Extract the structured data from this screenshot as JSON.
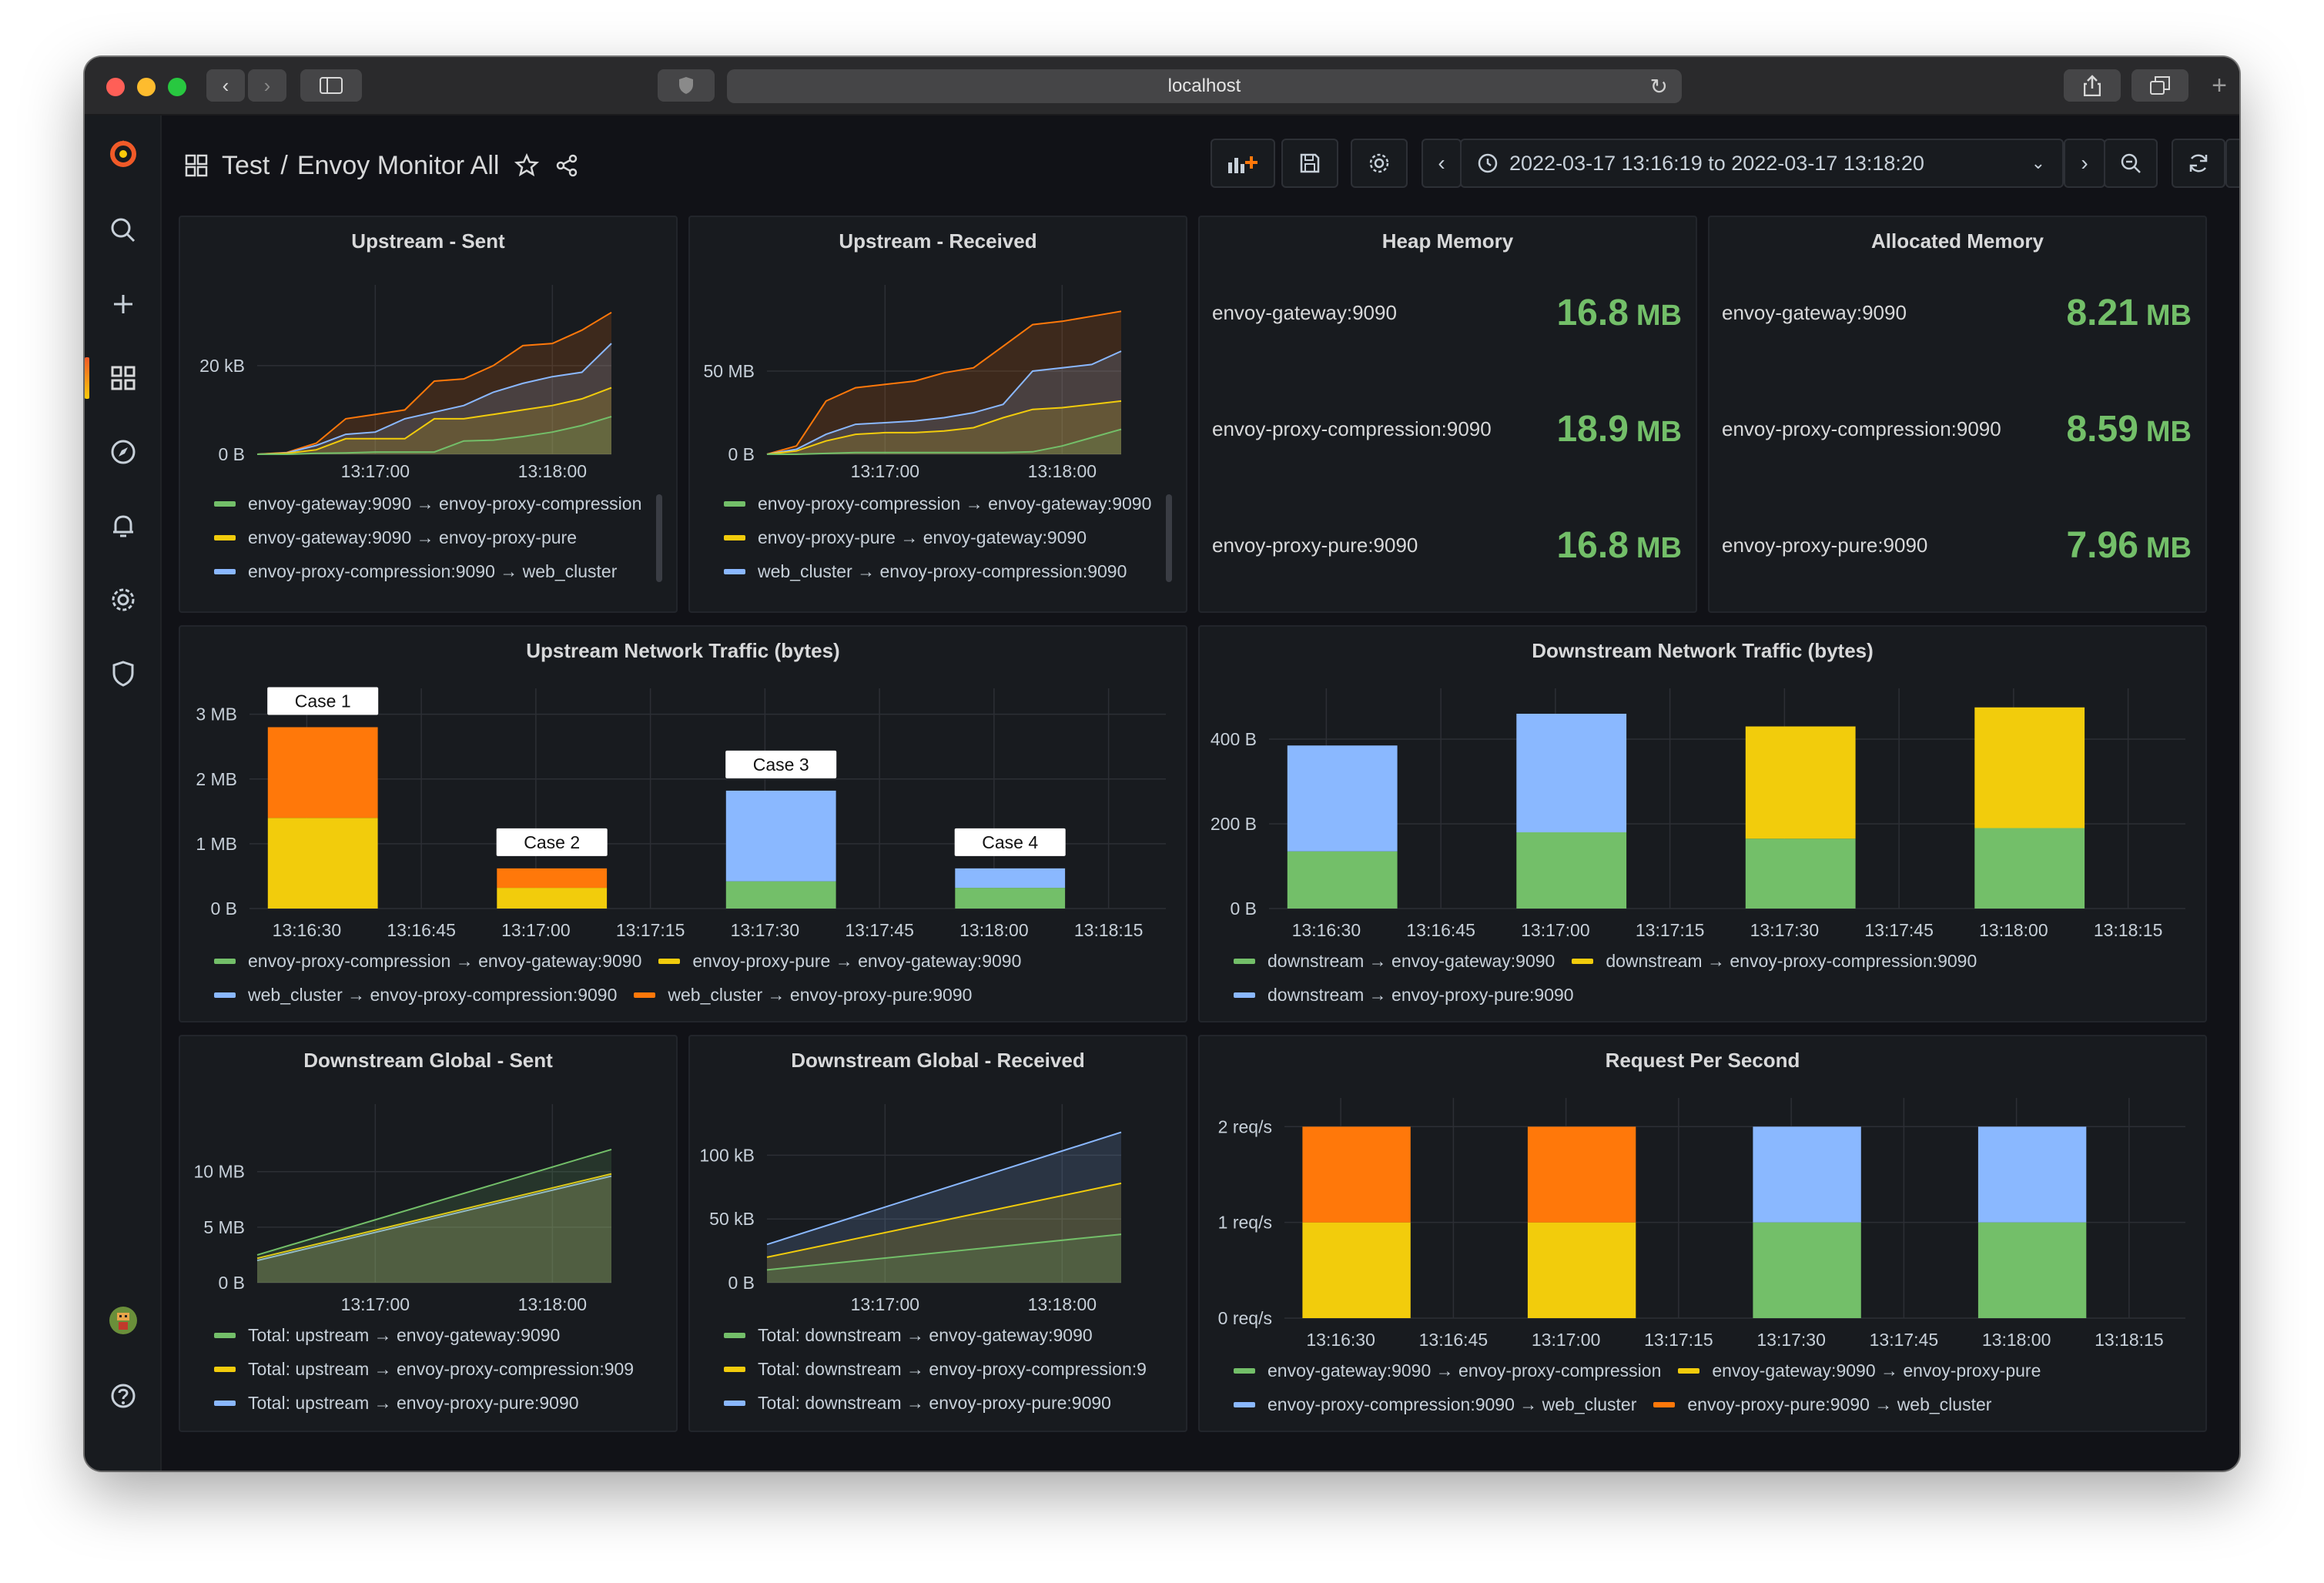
{
  "browser": {
    "url": "localhost"
  },
  "breadcrumb": {
    "folder": "Test",
    "separator": "/",
    "dashboard": "Envoy Monitor All"
  },
  "timepicker": {
    "range": "2022-03-17 13:16:19 to 2022-03-17 13:18:20"
  },
  "colors": {
    "green": "#73bf69",
    "yellow": "#f2cc0c",
    "blue": "#8ab8ff",
    "orange": "#ff780a",
    "stat": "#73bf69"
  },
  "panels": {
    "upstream_sent": {
      "title": "Upstream - Sent",
      "legend": [
        {
          "label": "envoy-gateway:9090 → envoy-proxy-compression",
          "color": "#73bf69"
        },
        {
          "label": "envoy-gateway:9090 → envoy-proxy-pure",
          "color": "#f2cc0c"
        },
        {
          "label": "envoy-proxy-compression:9090 → web_cluster",
          "color": "#8ab8ff"
        }
      ]
    },
    "upstream_received": {
      "title": "Upstream - Received",
      "legend": [
        {
          "label": "envoy-proxy-compression → envoy-gateway:9090",
          "color": "#73bf69"
        },
        {
          "label": "envoy-proxy-pure → envoy-gateway:9090",
          "color": "#f2cc0c"
        },
        {
          "label": "web_cluster → envoy-proxy-compression:9090",
          "color": "#8ab8ff"
        }
      ]
    },
    "heap_memory": {
      "title": "Heap Memory",
      "rows": [
        {
          "name": "envoy-gateway:9090",
          "value": "16.8",
          "unit": "MB"
        },
        {
          "name": "envoy-proxy-compression:9090",
          "value": "18.9",
          "unit": "MB"
        },
        {
          "name": "envoy-proxy-pure:9090",
          "value": "16.8",
          "unit": "MB"
        }
      ]
    },
    "allocated_memory": {
      "title": "Allocated Memory",
      "rows": [
        {
          "name": "envoy-gateway:9090",
          "value": "8.21",
          "unit": "MB"
        },
        {
          "name": "envoy-proxy-compression:9090",
          "value": "8.59",
          "unit": "MB"
        },
        {
          "name": "envoy-proxy-pure:9090",
          "value": "7.96",
          "unit": "MB"
        }
      ]
    },
    "upstream_traffic": {
      "title": "Upstream Network Traffic (bytes)",
      "legend": [
        {
          "label": "envoy-proxy-compression → envoy-gateway:9090",
          "color": "#73bf69"
        },
        {
          "label": "envoy-proxy-pure → envoy-gateway:9090",
          "color": "#f2cc0c"
        },
        {
          "label": "web_cluster → envoy-proxy-compression:9090",
          "color": "#8ab8ff"
        },
        {
          "label": "web_cluster → envoy-proxy-pure:9090",
          "color": "#ff780a"
        }
      ]
    },
    "downstream_traffic": {
      "title": "Downstream Network Traffic (bytes)",
      "legend": [
        {
          "label": "downstream → envoy-gateway:9090",
          "color": "#73bf69"
        },
        {
          "label": "downstream → envoy-proxy-compression:9090",
          "color": "#f2cc0c"
        },
        {
          "label": "downstream → envoy-proxy-pure:9090",
          "color": "#8ab8ff"
        }
      ]
    },
    "downstream_sent": {
      "title": "Downstream Global - Sent",
      "legend": [
        {
          "label": "Total: upstream → envoy-gateway:9090",
          "color": "#73bf69"
        },
        {
          "label": "Total: upstream → envoy-proxy-compression:909",
          "color": "#f2cc0c"
        },
        {
          "label": "Total: upstream → envoy-proxy-pure:9090",
          "color": "#8ab8ff"
        }
      ]
    },
    "downstream_received": {
      "title": "Downstream Global - Received",
      "legend": [
        {
          "label": "Total: downstream → envoy-gateway:9090",
          "color": "#73bf69"
        },
        {
          "label": "Total: downstream → envoy-proxy-compression:9",
          "color": "#f2cc0c"
        },
        {
          "label": "Total: downstream → envoy-proxy-pure:9090",
          "color": "#8ab8ff"
        }
      ]
    },
    "rps": {
      "title": "Request Per Second",
      "legend": [
        {
          "label": "envoy-gateway:9090 → envoy-proxy-compression",
          "color": "#73bf69"
        },
        {
          "label": "envoy-gateway:9090 → envoy-proxy-pure",
          "color": "#f2cc0c"
        },
        {
          "label": "envoy-proxy-compression:9090 → web_cluster",
          "color": "#8ab8ff"
        },
        {
          "label": "envoy-proxy-pure:9090 → web_cluster",
          "color": "#ff780a"
        }
      ]
    }
  },
  "chart_data": [
    {
      "id": "upstream_sent",
      "type": "area",
      "stacked": true,
      "unit": "kB",
      "x": [
        "13:16:20",
        "13:16:30",
        "13:16:40",
        "13:16:50",
        "13:17:00",
        "13:17:10",
        "13:17:20",
        "13:17:30",
        "13:17:40",
        "13:17:50",
        "13:18:00",
        "13:18:10",
        "13:18:20"
      ],
      "xticks": [
        "13:17:00",
        "13:18:00"
      ],
      "yticks": [
        {
          "v": 0,
          "label": "0 B"
        },
        {
          "v": 20,
          "label": "20 kB"
        }
      ],
      "ylim": [
        0,
        33
      ],
      "series": [
        {
          "name": "envoy-gateway:9090 → envoy-proxy-compression",
          "color": "#73bf69",
          "values": [
            0,
            0,
            0.2,
            0.3,
            0.5,
            0.5,
            0.5,
            3,
            3.2,
            4,
            5,
            6.5,
            8.5
          ]
        },
        {
          "name": "envoy-gateway:9090 → envoy-proxy-pure",
          "color": "#f2cc0c",
          "values": [
            0,
            0.2,
            1,
            3.5,
            3.5,
            3.5,
            8,
            8,
            9,
            10,
            11,
            12.5,
            15
          ]
        },
        {
          "name": "envoy-proxy-compression:9090 → web_cluster",
          "color": "#8ab8ff",
          "values": [
            0,
            0.3,
            2,
            4.5,
            5,
            8,
            9.5,
            11,
            14,
            16,
            17.5,
            18.5,
            25
          ]
        },
        {
          "name": "",
          "color": "#ff780a",
          "values": [
            0,
            0.4,
            2.5,
            8,
            9,
            10,
            16.5,
            17,
            20,
            24.5,
            25,
            28,
            32
          ]
        }
      ]
    },
    {
      "id": "upstream_received",
      "type": "area",
      "stacked": true,
      "unit": "MB",
      "x": [
        "13:16:20",
        "13:16:30",
        "13:16:40",
        "13:16:50",
        "13:17:00",
        "13:17:10",
        "13:17:20",
        "13:17:30",
        "13:17:40",
        "13:17:50",
        "13:18:00",
        "13:18:10",
        "13:18:20"
      ],
      "xticks": [
        "13:17:00",
        "13:18:00"
      ],
      "yticks": [
        {
          "v": 0,
          "label": "0 B"
        },
        {
          "v": 50,
          "label": "50 MB"
        }
      ],
      "ylim": [
        0,
        88
      ],
      "series": [
        {
          "name": "envoy-proxy-compression → envoy-gateway:9090",
          "color": "#73bf69",
          "values": [
            0,
            0,
            0.5,
            1,
            1,
            1,
            1,
            1,
            1,
            1.5,
            5,
            10,
            15
          ]
        },
        {
          "name": "envoy-proxy-pure → envoy-gateway:9090",
          "color": "#f2cc0c",
          "values": [
            0,
            2,
            8,
            12,
            13,
            13,
            14,
            16,
            22,
            27,
            28,
            30,
            32
          ]
        },
        {
          "name": "web_cluster → envoy-proxy-compression:9090",
          "color": "#8ab8ff",
          "values": [
            0,
            3,
            12,
            18,
            19,
            20,
            22,
            25,
            30,
            50,
            52,
            54,
            62
          ]
        },
        {
          "name": "",
          "color": "#ff780a",
          "values": [
            0,
            5,
            32,
            40,
            42,
            44,
            49,
            52,
            65,
            78,
            80,
            83,
            86
          ]
        }
      ]
    },
    {
      "id": "upstream_traffic",
      "type": "bar",
      "stacked": true,
      "x_ticks": [
        "13:16:30",
        "13:16:45",
        "13:17:00",
        "13:17:15",
        "13:17:30",
        "13:17:45",
        "13:18:00",
        "13:18:15"
      ],
      "yticks": [
        {
          "v": 0,
          "label": "0 B"
        },
        {
          "v": 1,
          "label": "1 MB"
        },
        {
          "v": 2,
          "label": "2 MB"
        },
        {
          "v": 3,
          "label": "3 MB"
        }
      ],
      "ylim": [
        0,
        3.4
      ],
      "groups": [
        {
          "label": "Case 1",
          "values": [
            {
              "color": "#f2cc0c",
              "v": 1.4
            },
            {
              "color": "#ff780a",
              "v": 1.4
            }
          ]
        },
        {
          "label": "Case 2",
          "values": [
            {
              "color": "#f2cc0c",
              "v": 0.32
            },
            {
              "color": "#ff780a",
              "v": 0.3
            }
          ]
        },
        {
          "label": "Case 3",
          "values": [
            {
              "color": "#73bf69",
              "v": 0.42
            },
            {
              "color": "#8ab8ff",
              "v": 1.4
            }
          ]
        },
        {
          "label": "Case 4",
          "values": [
            {
              "color": "#73bf69",
              "v": 0.32
            },
            {
              "color": "#8ab8ff",
              "v": 0.3
            }
          ]
        }
      ]
    },
    {
      "id": "downstream_traffic",
      "type": "bar",
      "stacked": true,
      "unit": "B",
      "x_ticks": [
        "13:16:30",
        "13:16:45",
        "13:17:00",
        "13:17:15",
        "13:17:30",
        "13:17:45",
        "13:18:00",
        "13:18:15"
      ],
      "yticks": [
        {
          "v": 0,
          "label": "0 B"
        },
        {
          "v": 200,
          "label": "200 B"
        },
        {
          "v": 400,
          "label": "400 B"
        }
      ],
      "ylim": [
        0,
        520
      ],
      "groups": [
        {
          "values": [
            {
              "color": "#73bf69",
              "v": 135
            },
            {
              "color": "#8ab8ff",
              "v": 250
            }
          ]
        },
        {
          "values": [
            {
              "color": "#73bf69",
              "v": 180
            },
            {
              "color": "#8ab8ff",
              "v": 280
            }
          ]
        },
        {
          "values": [
            {
              "color": "#73bf69",
              "v": 165
            },
            {
              "color": "#f2cc0c",
              "v": 265
            }
          ]
        },
        {
          "values": [
            {
              "color": "#73bf69",
              "v": 190
            },
            {
              "color": "#f2cc0c",
              "v": 285
            }
          ]
        }
      ]
    },
    {
      "id": "downstream_sent",
      "type": "line",
      "fill_area": true,
      "unit": "MB",
      "x": [
        "13:16:20",
        "13:18:20"
      ],
      "xticks": [
        "13:17:00",
        "13:18:00"
      ],
      "yticks": [
        {
          "v": 0,
          "label": "0 B"
        },
        {
          "v": 5,
          "label": "5 MB"
        },
        {
          "v": 10,
          "label": "10 MB"
        }
      ],
      "ylim": [
        0,
        14
      ],
      "series": [
        {
          "name": "Total: upstream → envoy-gateway:9090",
          "color": "#73bf69",
          "values": [
            2.5,
            12
          ]
        },
        {
          "name": "Total: upstream → envoy-proxy-compression:909",
          "color": "#f2cc0c",
          "values": [
            2.2,
            9.8
          ]
        },
        {
          "name": "Total: upstream → envoy-proxy-pure:9090",
          "color": "#8ab8ff",
          "values": [
            2,
            9.6
          ]
        }
      ]
    },
    {
      "id": "downstream_received",
      "type": "line",
      "fill_area": true,
      "unit": "kB",
      "x": [
        "13:16:20",
        "13:18:20"
      ],
      "xticks": [
        "13:17:00",
        "13:18:00"
      ],
      "yticks": [
        {
          "v": 0,
          "label": "0 B"
        },
        {
          "v": 50,
          "label": "50 kB"
        },
        {
          "v": 100,
          "label": "100 kB"
        }
      ],
      "ylim": [
        0,
        122
      ],
      "series": [
        {
          "name": "Total: downstream → envoy-gateway:9090",
          "color": "#73bf69",
          "values": [
            10,
            38
          ]
        },
        {
          "name": "Total: downstream → envoy-proxy-compression:9",
          "color": "#f2cc0c",
          "values": [
            20,
            78
          ]
        },
        {
          "name": "Total: downstream → envoy-proxy-pure:9090",
          "color": "#8ab8ff",
          "values": [
            30,
            118
          ]
        }
      ]
    },
    {
      "id": "rps",
      "type": "bar",
      "stacked": true,
      "unit": "req/s",
      "x_ticks": [
        "13:16:30",
        "13:16:45",
        "13:17:00",
        "13:17:15",
        "13:17:30",
        "13:17:45",
        "13:18:00",
        "13:18:15"
      ],
      "yticks": [
        {
          "v": 0,
          "label": "0 req/s"
        },
        {
          "v": 1,
          "label": "1 req/s"
        },
        {
          "v": 2,
          "label": "2 req/s"
        }
      ],
      "ylim": [
        0,
        2.3
      ],
      "groups": [
        {
          "values": [
            {
              "color": "#f2cc0c",
              "v": 1
            },
            {
              "color": "#ff780a",
              "v": 1
            }
          ]
        },
        {
          "values": [
            {
              "color": "#f2cc0c",
              "v": 1
            },
            {
              "color": "#ff780a",
              "v": 1
            }
          ]
        },
        {
          "values": [
            {
              "color": "#73bf69",
              "v": 1
            },
            {
              "color": "#8ab8ff",
              "v": 1
            }
          ]
        },
        {
          "values": [
            {
              "color": "#73bf69",
              "v": 1
            },
            {
              "color": "#8ab8ff",
              "v": 1
            }
          ]
        }
      ]
    }
  ]
}
